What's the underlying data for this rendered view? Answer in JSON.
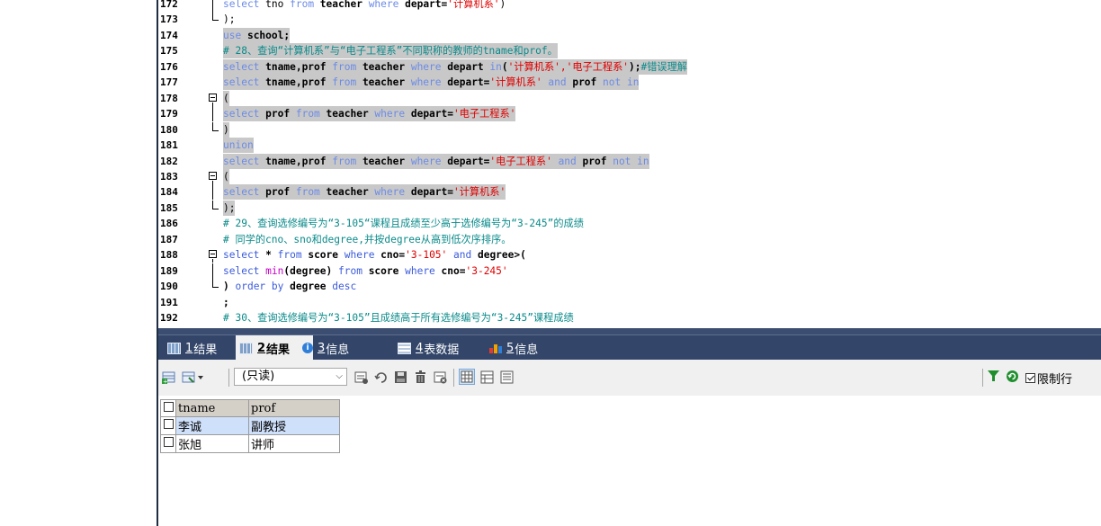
{
  "editor": {
    "lines": [
      {
        "num": "172",
        "sel": false,
        "segs": [
          [
            "kwl",
            "select "
          ],
          [
            "n",
            "tno "
          ],
          [
            "kwl",
            "from "
          ],
          [
            "ident",
            "teacher "
          ],
          [
            "kwl",
            "where "
          ],
          [
            "ident",
            "depart="
          ],
          [
            "str",
            "'计算机系'"
          ],
          [
            "n",
            ")"
          ]
        ]
      },
      {
        "num": "173",
        "sel": false,
        "segs": [
          [
            "n",
            ");"
          ]
        ]
      },
      {
        "num": "174",
        "sel": true,
        "segs": [
          [
            "kwl",
            "use "
          ],
          [
            "ident",
            "school;"
          ]
        ]
      },
      {
        "num": "175",
        "sel": true,
        "segs": [
          [
            "cmt",
            "# 28、查询“计算机系”与“电子工程系”不同职称的教师的tname和prof。"
          ]
        ]
      },
      {
        "num": "176",
        "sel": true,
        "segs": [
          [
            "kwl",
            "select "
          ],
          [
            "ident",
            "tname,prof "
          ],
          [
            "kwl",
            "from "
          ],
          [
            "ident",
            "teacher "
          ],
          [
            "kwl",
            "where "
          ],
          [
            "ident",
            "depart "
          ],
          [
            "kwl",
            "in"
          ],
          [
            "ident",
            "("
          ],
          [
            "str",
            "'计算机系','电子工程系'"
          ],
          [
            "ident",
            ");"
          ],
          [
            "cmt",
            "#错误理解"
          ]
        ]
      },
      {
        "num": "177",
        "sel": true,
        "segs": [
          [
            "kwl",
            "select "
          ],
          [
            "ident",
            "tname,prof "
          ],
          [
            "kwl",
            "from "
          ],
          [
            "ident",
            "teacher "
          ],
          [
            "kwl",
            "where "
          ],
          [
            "ident",
            "depart="
          ],
          [
            "str",
            "'计算机系' "
          ],
          [
            "kwl",
            "and "
          ],
          [
            "ident",
            "prof "
          ],
          [
            "kwl",
            "not in"
          ]
        ]
      },
      {
        "num": "178",
        "sel": true,
        "segs": [
          [
            "n",
            "("
          ]
        ]
      },
      {
        "num": "179",
        "sel": true,
        "segs": [
          [
            "kwl",
            "select "
          ],
          [
            "ident",
            "prof "
          ],
          [
            "kwl",
            "from "
          ],
          [
            "ident",
            "teacher "
          ],
          [
            "kwl",
            "where "
          ],
          [
            "ident",
            "depart="
          ],
          [
            "str",
            "'电子工程系'"
          ]
        ]
      },
      {
        "num": "180",
        "sel": true,
        "segs": [
          [
            "n",
            ")"
          ]
        ]
      },
      {
        "num": "181",
        "sel": true,
        "segs": [
          [
            "kwl",
            "union"
          ]
        ]
      },
      {
        "num": "182",
        "sel": true,
        "segs": [
          [
            "kwl",
            "select "
          ],
          [
            "ident",
            "tname,prof "
          ],
          [
            "kwl",
            "from "
          ],
          [
            "ident",
            "teacher "
          ],
          [
            "kwl",
            "where "
          ],
          [
            "ident",
            "depart="
          ],
          [
            "str",
            "'电子工程系' "
          ],
          [
            "kwl",
            "and "
          ],
          [
            "ident",
            "prof "
          ],
          [
            "kwl",
            "not in"
          ]
        ]
      },
      {
        "num": "183",
        "sel": true,
        "segs": [
          [
            "n",
            "("
          ]
        ]
      },
      {
        "num": "184",
        "sel": true,
        "segs": [
          [
            "kwl",
            "select "
          ],
          [
            "ident",
            "prof "
          ],
          [
            "kwl",
            "from "
          ],
          [
            "ident",
            "teacher "
          ],
          [
            "kwl",
            "where "
          ],
          [
            "ident",
            "depart="
          ],
          [
            "str",
            "'计算机系'"
          ]
        ]
      },
      {
        "num": "185",
        "sel": true,
        "segs": [
          [
            "n",
            ");"
          ]
        ]
      },
      {
        "num": "186",
        "sel": false,
        "segs": [
          [
            "cmt",
            "# 29、查询选修编号为“3-105“课程且成绩至少高于选修编号为“3-245”的成绩"
          ]
        ]
      },
      {
        "num": "187",
        "sel": false,
        "segs": [
          [
            "cmt",
            "# 同学的cno、sno和degree,并按degree从高到低次序排序。"
          ]
        ]
      },
      {
        "num": "188",
        "sel": false,
        "segs": [
          [
            "kw",
            "select "
          ],
          [
            "ident",
            "* "
          ],
          [
            "kw",
            "from "
          ],
          [
            "ident",
            "score "
          ],
          [
            "kw",
            "where "
          ],
          [
            "ident",
            "cno="
          ],
          [
            "str",
            "'3-105' "
          ],
          [
            "kw",
            "and "
          ],
          [
            "ident",
            "degree>("
          ]
        ]
      },
      {
        "num": "189",
        "sel": false,
        "segs": [
          [
            "kw",
            "select "
          ],
          [
            "fn",
            "min"
          ],
          [
            "ident",
            "(degree) "
          ],
          [
            "kw",
            "from "
          ],
          [
            "ident",
            "score "
          ],
          [
            "kw",
            "where "
          ],
          [
            "ident",
            "cno="
          ],
          [
            "str",
            "'3-245'"
          ]
        ]
      },
      {
        "num": "190",
        "sel": false,
        "segs": [
          [
            "ident",
            ") "
          ],
          [
            "kw",
            "order by "
          ],
          [
            "ident",
            "degree "
          ],
          [
            "kw",
            "desc"
          ]
        ]
      },
      {
        "num": "191",
        "sel": false,
        "segs": [
          [
            "ident",
            ";"
          ]
        ]
      },
      {
        "num": "192",
        "sel": false,
        "segs": [
          [
            "cmt",
            "# 30、查询选修编号为“3-105”且成绩高于所有选修编号为“3-245”课程成绩"
          ]
        ]
      }
    ]
  },
  "tabs": [
    {
      "num": "1",
      "label": "结果",
      "icon": "grid-icon",
      "active": false
    },
    {
      "num": "2",
      "label": "结果",
      "icon": "grid-icon",
      "active": true
    },
    {
      "num": "3",
      "label": "信息",
      "icon": "info-icon",
      "active": false
    },
    {
      "num": "4",
      "label": "表数据",
      "icon": "table-icon",
      "active": false
    },
    {
      "num": "5",
      "label": "信息",
      "icon": "chart-icon",
      "active": false
    }
  ],
  "toolbar": {
    "readonly_value": "(只读)",
    "limit_label": "限制行"
  },
  "grid": {
    "columns": [
      "tname",
      "prof"
    ],
    "rows": [
      {
        "tname": "李诚",
        "prof": "副教授",
        "selected": true
      },
      {
        "tname": "张旭",
        "prof": "讲师",
        "selected": false
      }
    ]
  },
  "colors": {
    "keyword": "#6c8be6",
    "string": "#e00000",
    "comment": "#0b8a8a",
    "tab_bar": "#33466a",
    "selection": "#c8c8c8"
  }
}
